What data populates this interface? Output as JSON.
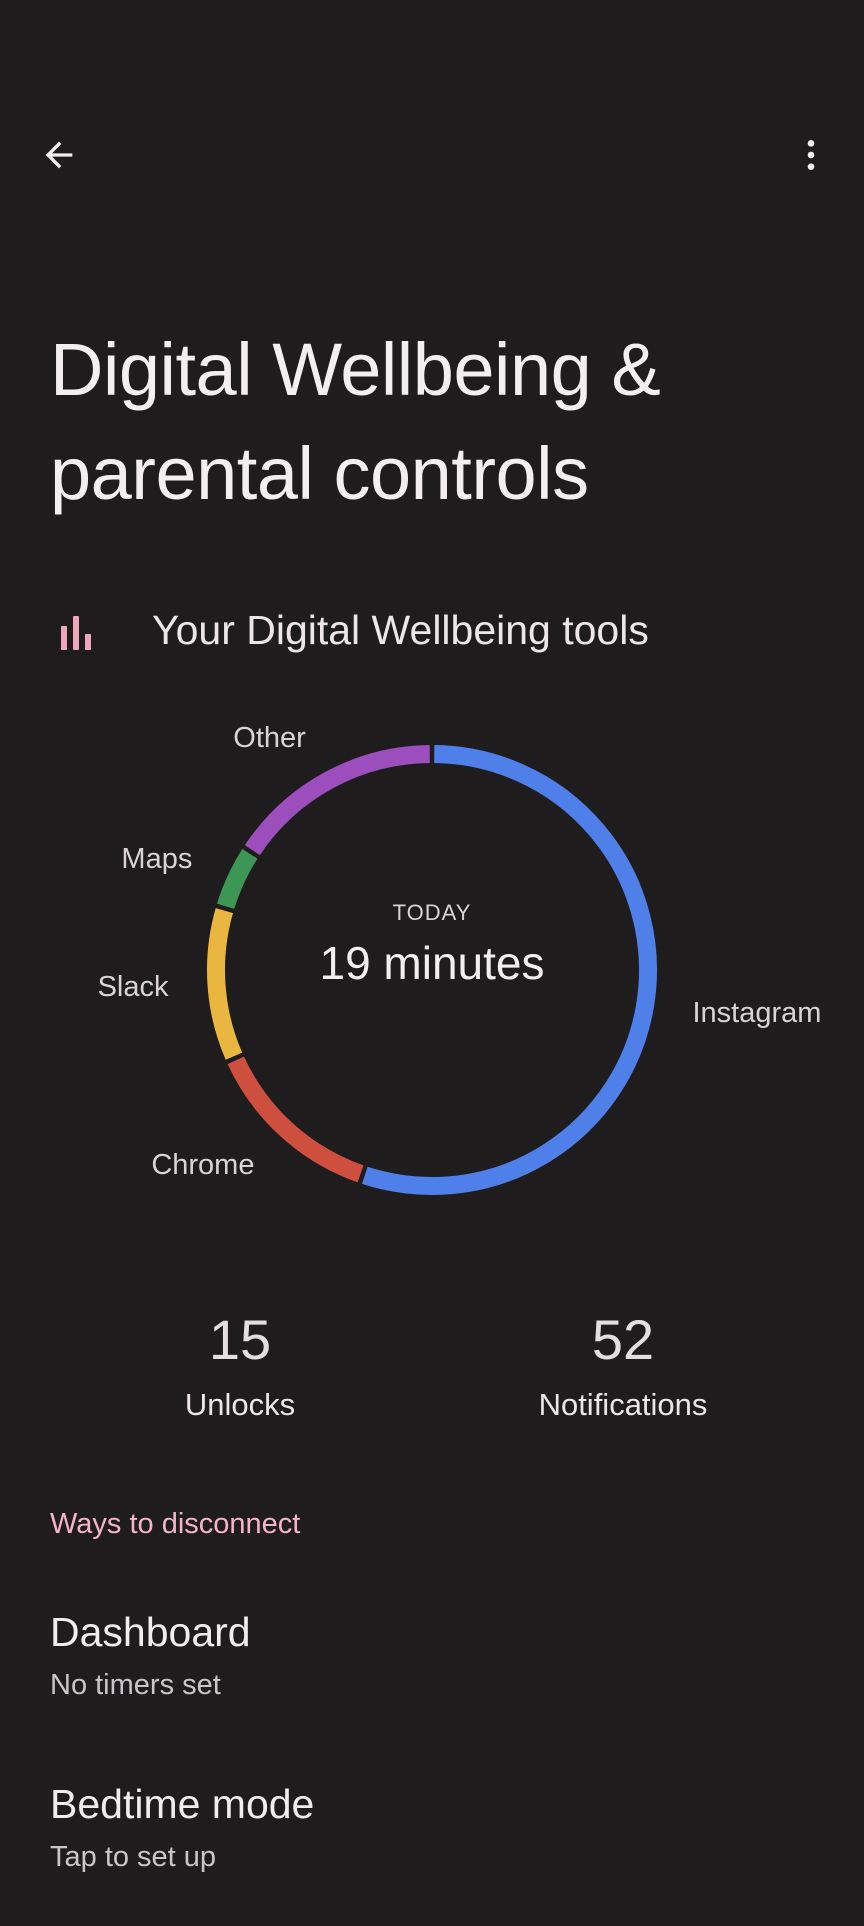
{
  "header": {
    "back_icon": "arrow-back-icon",
    "more_icon": "more-vert-icon"
  },
  "page": {
    "title": "Digital Wellbeing & parental controls"
  },
  "tools": {
    "icon": "bar-chart-icon",
    "label": "Your Digital Wellbeing tools"
  },
  "chart_data": {
    "type": "pie",
    "style": "donut",
    "center_caption": "TODAY",
    "center_value": "19 minutes",
    "slices": [
      {
        "label": "Instagram",
        "fraction": 0.552,
        "color": "#4f80ea"
      },
      {
        "label": "Chrome",
        "fraction": 0.131,
        "color": "#cf4f3f"
      },
      {
        "label": "Slack",
        "fraction": 0.113,
        "color": "#e9b63f"
      },
      {
        "label": "Maps",
        "fraction": 0.046,
        "color": "#3e9655"
      },
      {
        "label": "Other",
        "fraction": 0.158,
        "color": "#9c4ebd"
      }
    ]
  },
  "stats": {
    "unlocks": {
      "value": "15",
      "label": "Unlocks"
    },
    "notifications": {
      "value": "52",
      "label": "Notifications"
    }
  },
  "section": {
    "header": "Ways to disconnect"
  },
  "items": [
    {
      "title": "Dashboard",
      "subtitle": "No timers set"
    },
    {
      "title": "Bedtime mode",
      "subtitle": "Tap to set up"
    }
  ]
}
